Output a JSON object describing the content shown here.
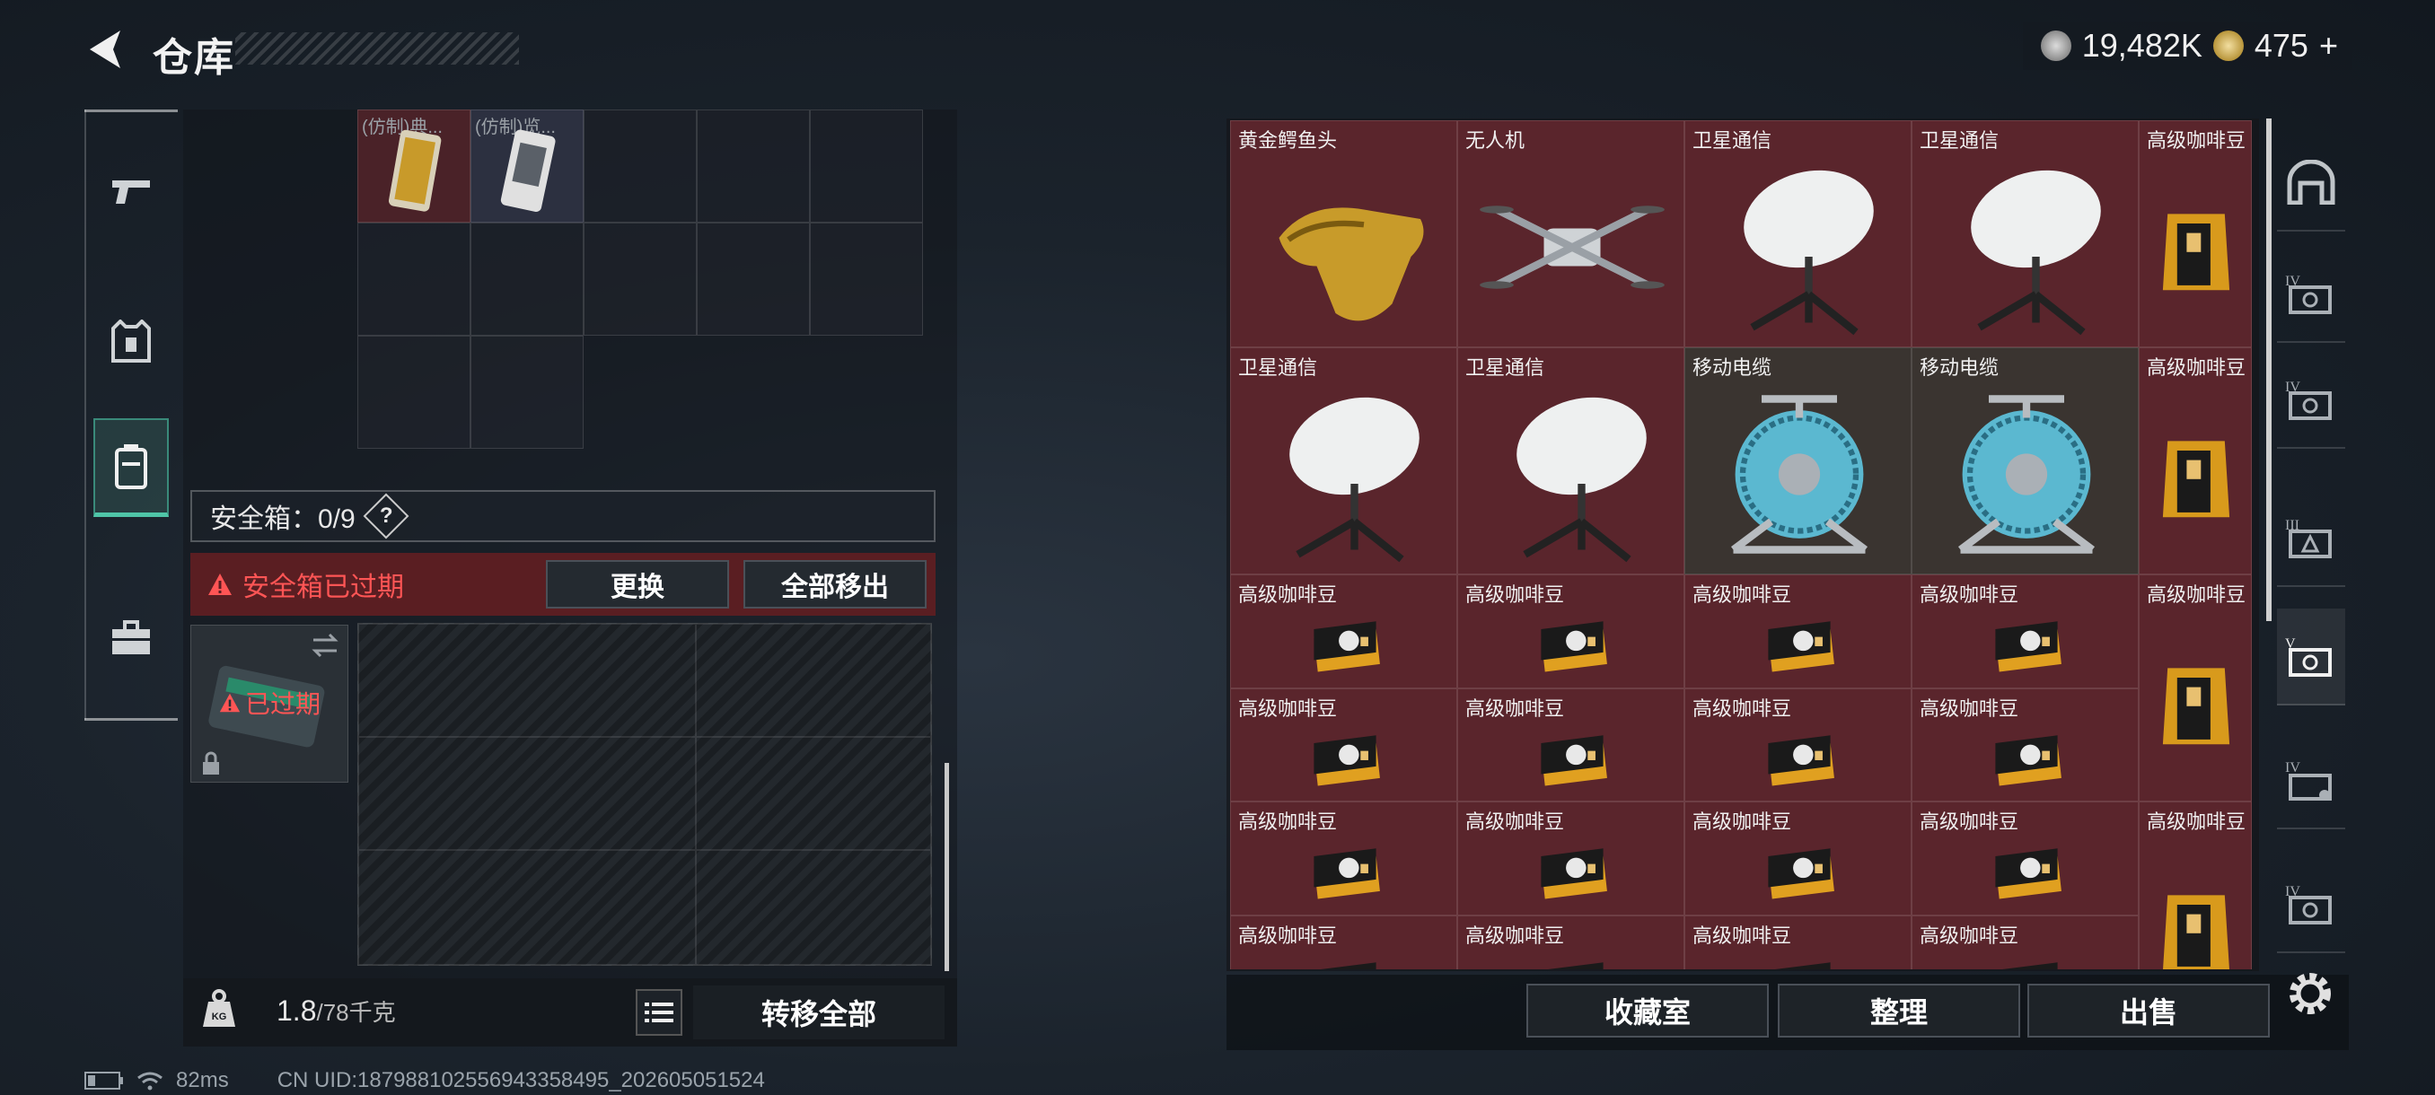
{
  "header": {
    "title": "仓库",
    "currency_1": "19,482K",
    "currency_2": "475",
    "plus": "+"
  },
  "left": {
    "items": [
      {
        "label": "(仿制)典..."
      },
      {
        "label": "(仿制)览..."
      }
    ],
    "safebox_label": "安全箱：0/9",
    "safebox_help": "?",
    "expired_message": "安全箱已过期",
    "replace_button": "更换",
    "remove_all_button": "全部移出",
    "expired_badge": "已过期",
    "weight_value": "1.8",
    "weight_max": "/78千克",
    "transfer_all_button": "转移全部"
  },
  "stash": {
    "cells": [
      {
        "label": "黄金鳄鱼头",
        "icon": "golden-croc-head"
      },
      {
        "label": "无人机",
        "icon": "drone"
      },
      {
        "label": "卫星通信",
        "icon": "satellite-dish"
      },
      {
        "label": "卫星通信",
        "icon": "satellite-dish"
      },
      {
        "label": "高级咖啡豆",
        "icon": "coffee-bag"
      },
      {
        "label": "卫星通信",
        "icon": "satellite-dish"
      },
      {
        "label": "卫星通信",
        "icon": "satellite-dish"
      },
      {
        "label": "移动电缆",
        "icon": "cable-reel"
      },
      {
        "label": "移动电缆",
        "icon": "cable-reel"
      },
      {
        "label": "高级咖啡豆",
        "icon": "coffee-bag"
      },
      {
        "label": "高级咖啡豆",
        "icon": "coffee-box"
      },
      {
        "label": "高级咖啡豆",
        "icon": "coffee-box"
      },
      {
        "label": "高级咖啡豆",
        "icon": "coffee-box"
      },
      {
        "label": "高级咖啡豆",
        "icon": "coffee-box"
      },
      {
        "label": "高级咖啡豆",
        "icon": "coffee-bag"
      },
      {
        "label": "高级咖啡豆",
        "icon": "coffee-box"
      },
      {
        "label": "高级咖啡豆",
        "icon": "coffee-box"
      },
      {
        "label": "高级咖啡豆",
        "icon": "coffee-box"
      },
      {
        "label": "高级咖啡豆",
        "icon": "coffee-box"
      },
      {
        "label": "高级咖啡豆",
        "icon": "coffee-box"
      },
      {
        "label": "高级咖啡豆",
        "icon": "coffee-box"
      },
      {
        "label": "高级咖啡豆",
        "icon": "coffee-box"
      },
      {
        "label": "高级咖啡豆",
        "icon": "coffee-box"
      },
      {
        "label": "高级咖啡豆",
        "icon": "coffee-bag"
      },
      {
        "label": "高级咖啡豆",
        "icon": "coffee-box"
      },
      {
        "label": "高级咖啡豆",
        "icon": "coffee-box"
      },
      {
        "label": "高级咖啡豆",
        "icon": "coffee-box"
      },
      {
        "label": "高级咖啡豆",
        "icon": "coffee-box"
      }
    ]
  },
  "footer": {
    "collection_button": "收藏室",
    "sort_button": "整理",
    "sell_button": "出售"
  },
  "status": {
    "ping": "82ms",
    "uid": "CN UID:1879881025569433584​95_202605051524"
  },
  "colors": {
    "accent_teal": "#4fc5a8",
    "expired_red": "#ff5555",
    "stash_cell": "#5a252c"
  }
}
